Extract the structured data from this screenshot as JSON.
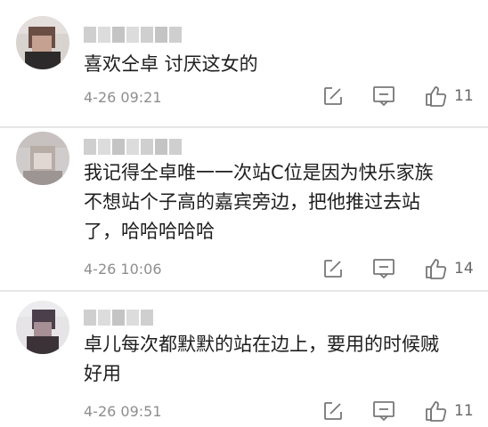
{
  "comments": [
    {
      "content": "喜欢仝卓 讨厌这女的",
      "date": "4-26 09:21",
      "likes": "11",
      "actions": {
        "edit_icon": "edit-icon",
        "reply_icon": "comment-icon",
        "like_icon": "thumbs-up-icon"
      }
    },
    {
      "content": "我记得仝卓唯一一次站C位是因为快乐家族\n不想站个子高的嘉宾旁边，把他推过去站\n了，哈哈哈哈哈",
      "date": "4-26 10:06",
      "likes": "14",
      "actions": {
        "edit_icon": "edit-icon",
        "reply_icon": "comment-icon",
        "like_icon": "thumbs-up-icon"
      }
    },
    {
      "content": "卓儿每次都默默的站在边上，要用的时候贼\n好用",
      "date": "4-26 09:51",
      "likes": "11",
      "actions": {
        "edit_icon": "edit-icon",
        "reply_icon": "comment-icon",
        "like_icon": "thumbs-up-icon"
      }
    }
  ],
  "colors": {
    "text": "#1e1e1e",
    "meta": "#8e8e8e",
    "icon": "#777777",
    "separator": "#e6e6e6"
  }
}
